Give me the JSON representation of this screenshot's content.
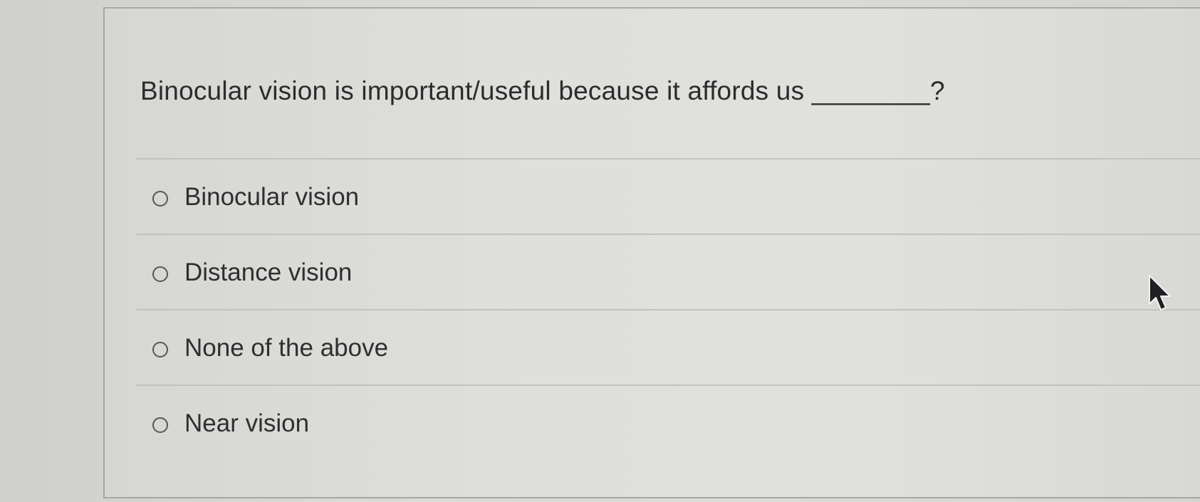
{
  "question": {
    "text": "Binocular vision is important/useful because it affords us ________?"
  },
  "answers": [
    {
      "label": "Binocular vision",
      "selected": false
    },
    {
      "label": "Distance vision",
      "selected": false
    },
    {
      "label": "None of the above",
      "selected": false
    },
    {
      "label": "Near vision",
      "selected": false
    }
  ],
  "icons": {
    "radio": "radio-unselected-icon",
    "cursor": "mouse-pointer-icon"
  }
}
